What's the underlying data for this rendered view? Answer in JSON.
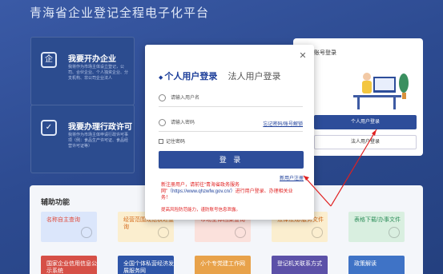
{
  "header": {
    "title": "青海省企业登记全程电子化平台"
  },
  "cards": [
    {
      "icon": "企",
      "title": "我要开办企业",
      "desc": "我将作为市场主体设立登记，公司、合伙企业、个人独资企业、分支机构、非公司企业法人"
    },
    {
      "icon": "✓",
      "title": "我要办理行政许可",
      "desc": "我将作为市场主体申请行政许可事项（例：食品生产许可证、食品经营许可证等）"
    }
  ],
  "right_panel": {
    "title": "账号登录",
    "btn_personal": "个人用户登录",
    "btn_legal": "法人用户登录"
  },
  "aux": {
    "title": "辅助功能",
    "tiles": [
      "名称自主查询",
      "经营范围规范表述查询",
      "市场主体档案查询",
      "法律法规/服务文件",
      "表格下载/办事文件",
      "国家企业信用信息公示系统",
      "全国个体私营经济发展服务网",
      "小个专党建工作网",
      "登记机关联系方式",
      "政策解读"
    ]
  },
  "modal": {
    "tab_personal": "个人用户登录",
    "tab_legal": "法人用户登录",
    "username_placeholder": "请输入用户名",
    "password_placeholder": "请输入密码",
    "forgot": "忘记密码/账号解锁",
    "remember": "记住密码",
    "login": "登 录",
    "register": "新用户注册",
    "notice_1": "新注册用户，请前往“青海省政务服务网”",
    "notice_link": "（https://www.qhzwfw.gov.cn/）",
    "notice_2": "进行用户登录、办理相关业务！",
    "risk": "提高风险防范能力，谨防账号信息泄露。"
  },
  "colors": {
    "primary": "#2d4d9a",
    "notice": "#e02020"
  }
}
